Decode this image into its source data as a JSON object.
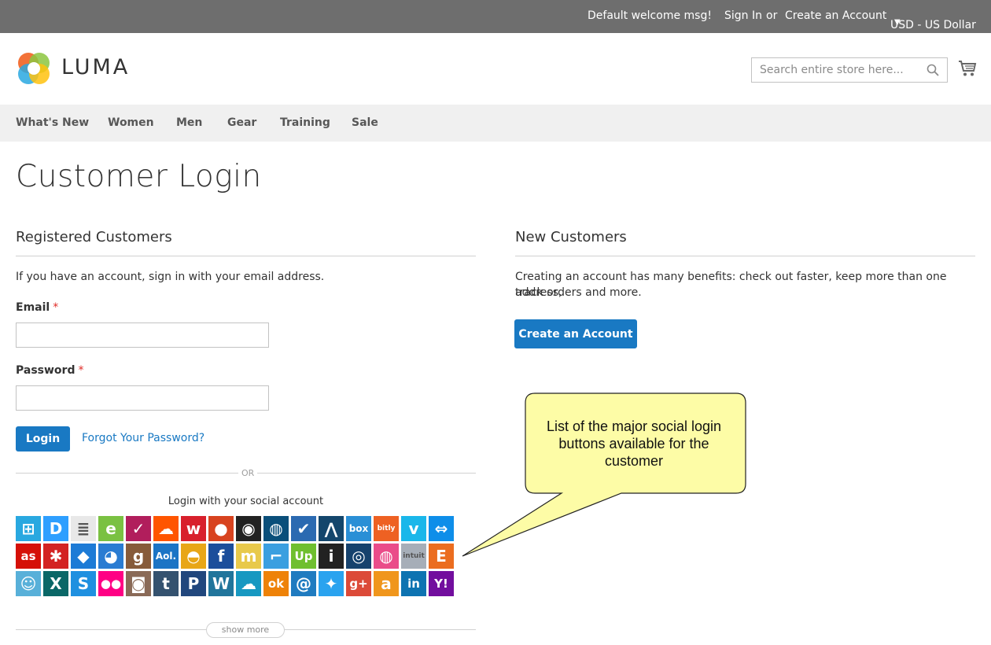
{
  "topbar": {
    "welcome": "Default welcome msg!",
    "sign_in": "Sign In",
    "or": "or",
    "create_account": "Create an Account",
    "currency": "USD - US Dollar"
  },
  "header": {
    "logo_text": "LUMA",
    "search_placeholder": "Search entire store here...",
    "logo_colors": [
      "#f26322",
      "#29a8e0",
      "#8cc63f",
      "#ffc20e"
    ]
  },
  "nav": {
    "items": [
      "What's New",
      "Women",
      "Men",
      "Gear",
      "Training",
      "Sale"
    ]
  },
  "page_title": "Customer Login",
  "registered": {
    "title": "Registered Customers",
    "intro": "If you have an account, sign in with your email address.",
    "email_label": "Email",
    "password_label": "Password",
    "required_mark": "*",
    "login_button": "Login",
    "forgot_link": "Forgot Your Password?",
    "or_divider": "OR",
    "social_caption": "Login with your social account",
    "show_more": "show more"
  },
  "new_customers": {
    "title": "New Customers",
    "intro_line1": "Creating an account has many benefits: check out faster, keep more than one address,",
    "intro_line2": "track orders and more.",
    "create_button": "Create an Account"
  },
  "callout": {
    "line1": "List of the major social login",
    "line2": "buttons available for the",
    "line3": "customer"
  },
  "social_rows": [
    [
      {
        "name": "windows",
        "glyph": "⊞",
        "bg": "#29a8e0"
      },
      {
        "name": "disqus",
        "glyph": "D",
        "bg": "#2e9fff"
      },
      {
        "name": "stackoverflow",
        "glyph": "≣",
        "bg": "#e8e8e8"
      },
      {
        "name": "evernote",
        "glyph": "e",
        "bg": "#7ac142"
      },
      {
        "name": "foursquare-checkin",
        "glyph": "✓",
        "bg": "#b11e5c"
      },
      {
        "name": "soundcloud",
        "glyph": "☁",
        "bg": "#ff5500"
      },
      {
        "name": "weibo",
        "glyph": "w",
        "bg": "#d8202c"
      },
      {
        "name": "persona",
        "glyph": "●",
        "bg": "#d8431f"
      },
      {
        "name": "github",
        "glyph": "◉",
        "bg": "#222222"
      },
      {
        "name": "instapaper",
        "glyph": "◍",
        "bg": "#0a4f7a"
      },
      {
        "name": "foursquare",
        "glyph": "✔",
        "bg": "#2b6ab1"
      },
      {
        "name": "wordpress-vip",
        "glyph": "⋀",
        "bg": "#14466c"
      },
      {
        "name": "box",
        "glyph": "box",
        "bg": "#2a8fd6"
      },
      {
        "name": "bitly",
        "glyph": "bitly",
        "bg": "#ee6123"
      },
      {
        "name": "vimeo",
        "glyph": "v",
        "bg": "#1ab7ea"
      },
      {
        "name": "teamviewer",
        "glyph": "⇔",
        "bg": "#0e8ee9"
      }
    ],
    [
      {
        "name": "lastfm",
        "glyph": "as",
        "bg": "#d51007"
      },
      {
        "name": "yelp",
        "glyph": "✱",
        "bg": "#d32323"
      },
      {
        "name": "dropbox",
        "glyph": "◆",
        "bg": "#1d7bd6"
      },
      {
        "name": "reddit",
        "glyph": "◕",
        "bg": "#2a7cd2"
      },
      {
        "name": "goodreads",
        "glyph": "g",
        "bg": "#875b3a"
      },
      {
        "name": "aol",
        "glyph": "Aol.",
        "bg": "#1b74c5"
      },
      {
        "name": "qq",
        "glyph": "◓",
        "bg": "#e8a617"
      },
      {
        "name": "facebook",
        "glyph": "f",
        "bg": "#1c4e9b"
      },
      {
        "name": "mailru",
        "glyph": "m",
        "bg": "#e8c94b"
      },
      {
        "name": "deviantart",
        "glyph": "⌐",
        "bg": "#3a9fe0"
      },
      {
        "name": "upwork",
        "glyph": "Up",
        "bg": "#6fbf2f"
      },
      {
        "name": "instagram-i",
        "glyph": "i",
        "bg": "#222222"
      },
      {
        "name": "wechat",
        "glyph": "◎",
        "bg": "#16426d"
      },
      {
        "name": "dribbble",
        "glyph": "◍",
        "bg": "#ea4c89"
      },
      {
        "name": "intuit",
        "glyph": "intuit",
        "bg": "#a6aeb8"
      },
      {
        "name": "etsy",
        "glyph": "E",
        "bg": "#eb6d20"
      }
    ],
    [
      {
        "name": "mailchimp",
        "glyph": "☺",
        "bg": "#58b0d9"
      },
      {
        "name": "xing",
        "glyph": "X",
        "bg": "#0a6767"
      },
      {
        "name": "skyrock",
        "glyph": "S",
        "bg": "#1f90e0"
      },
      {
        "name": "flickr",
        "glyph": "●●",
        "bg": "#ff0084"
      },
      {
        "name": "instagram",
        "glyph": "◙",
        "bg": "#8a6a57"
      },
      {
        "name": "tumblr",
        "glyph": "t",
        "bg": "#34526f"
      },
      {
        "name": "paypal",
        "glyph": "P",
        "bg": "#21477d"
      },
      {
        "name": "wordpress",
        "glyph": "W",
        "bg": "#21759b"
      },
      {
        "name": "salesforce",
        "glyph": "☁",
        "bg": "#1798c1"
      },
      {
        "name": "odnoklassniki",
        "glyph": "ok",
        "bg": "#ee8208"
      },
      {
        "name": "email",
        "glyph": "@",
        "bg": "#1f7bc0"
      },
      {
        "name": "twitter",
        "glyph": "✦",
        "bg": "#2aa3ef"
      },
      {
        "name": "google-plus",
        "glyph": "g+",
        "bg": "#dc4a38"
      },
      {
        "name": "amazon",
        "glyph": "a",
        "bg": "#f0961c"
      },
      {
        "name": "linkedin",
        "glyph": "in",
        "bg": "#0d73b1"
      },
      {
        "name": "yahoo",
        "glyph": "Y!",
        "bg": "#720e9e"
      }
    ]
  ]
}
